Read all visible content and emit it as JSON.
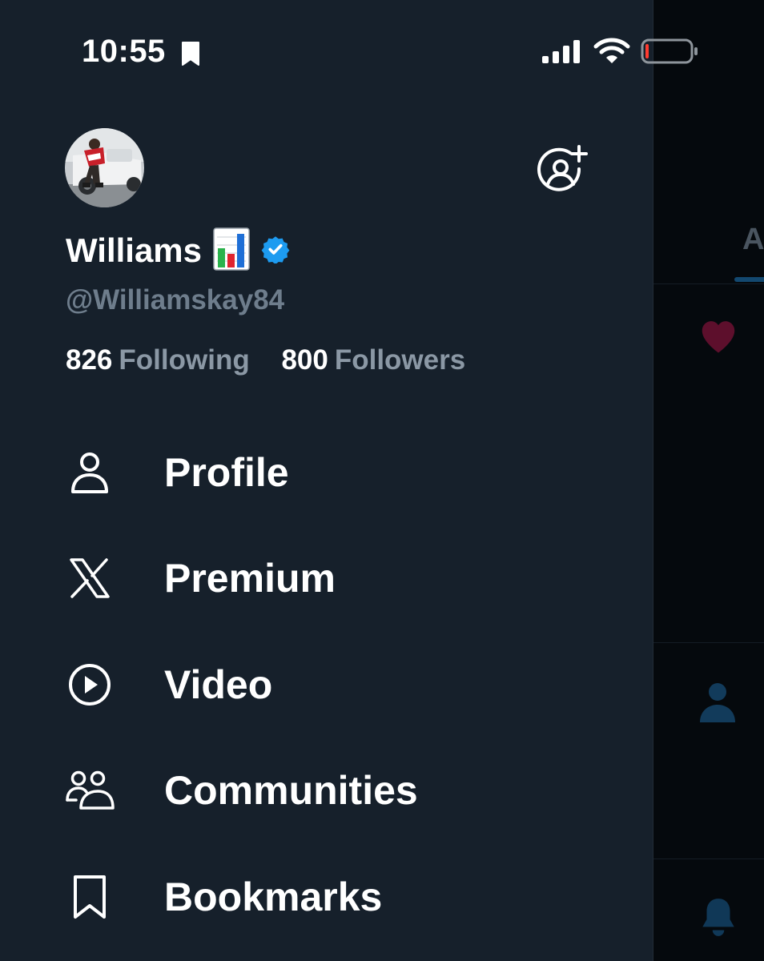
{
  "status_bar": {
    "time": "10:55",
    "icons": [
      "bookmark-icon",
      "cellular-signal-icon",
      "wifi-icon",
      "battery-low-icon"
    ]
  },
  "profile": {
    "display_name": "Williams",
    "name_emoji": "bar-chart-emoji",
    "verified": true,
    "verified_color": "#1d9bf0",
    "username": "@Williamskay84",
    "following_count": "826",
    "following_label": "Following",
    "followers_count": "800",
    "followers_label": "Followers",
    "add_account_icon": "add-account-icon"
  },
  "menu": {
    "items": [
      {
        "label": "Profile",
        "icon": "person-icon"
      },
      {
        "label": "Premium",
        "icon": "x-logo-icon"
      },
      {
        "label": "Video",
        "icon": "play-circle-icon"
      },
      {
        "label": "Communities",
        "icon": "communities-icon"
      },
      {
        "label": "Bookmarks",
        "icon": "bookmark-icon"
      }
    ]
  },
  "background": {
    "partial_tab_letter": "A",
    "accent_color": "#1d9bf0",
    "like_color": "#f91880"
  },
  "colors": {
    "drawer_bg": "#16202b",
    "text_primary": "#ffffff",
    "text_secondary": "#8b98a5"
  }
}
